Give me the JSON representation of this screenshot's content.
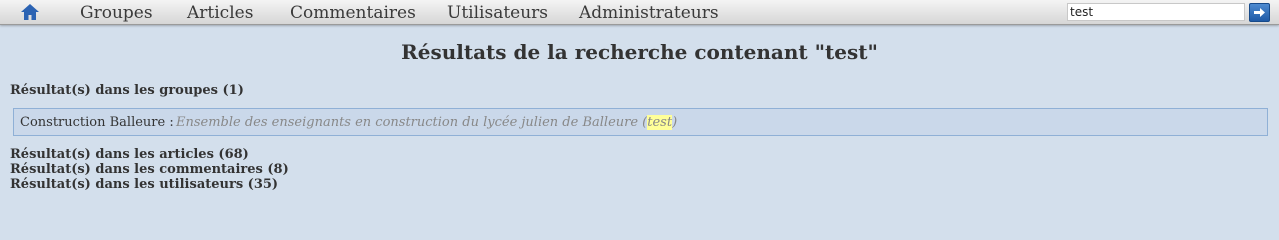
{
  "nav": {
    "items": [
      "Groupes",
      "Articles",
      "Commentaires",
      "Utilisateurs",
      "Administrateurs"
    ],
    "search_value": "test"
  },
  "page": {
    "title": "Résultats de la recherche contenant \"test\""
  },
  "sections": {
    "groups": "Résultat(s) dans les groupes (1)",
    "articles": "Résultat(s) dans les articles (68)",
    "comments": "Résultat(s) dans les commentaires (8)",
    "users": "Résultat(s) dans les utilisateurs (35)"
  },
  "group_result": {
    "name": "Construction Balleure",
    "separator": " : ",
    "desc_before": "Ensemble des enseignants en construction du lycée julien de Balleure (",
    "desc_highlight": "test",
    "desc_after": ")"
  },
  "colors": {
    "background": "#d3dfec",
    "result_box": "#cad8ea",
    "highlight": "#ffff99",
    "accent": "#1f5aa6"
  },
  "icons": {
    "home": "home-icon",
    "search_submit": "arrow-right-icon"
  }
}
